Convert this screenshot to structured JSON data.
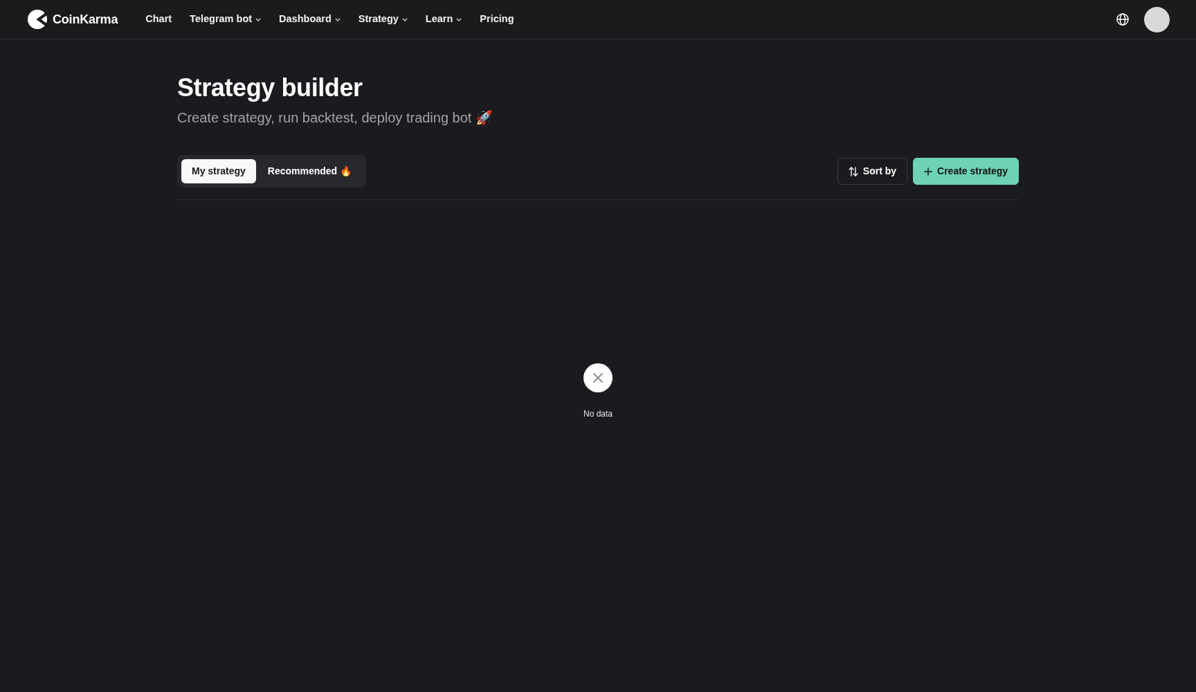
{
  "navbar": {
    "brand": "CoinKarma",
    "links": [
      {
        "label": "Chart",
        "has_menu": false
      },
      {
        "label": "Telegram bot",
        "has_menu": true
      },
      {
        "label": "Dashboard",
        "has_menu": true
      },
      {
        "label": "Strategy",
        "has_menu": true
      },
      {
        "label": "Learn",
        "has_menu": true
      },
      {
        "label": "Pricing",
        "has_menu": false
      }
    ]
  },
  "header": {
    "title": "Strategy builder",
    "subtitle": "Create strategy, run backtest, deploy trading bot 🚀"
  },
  "tabs": [
    {
      "label": "My strategy",
      "selected": true
    },
    {
      "label": "Recommended 🔥",
      "selected": false
    }
  ],
  "actions": [
    {
      "label": "Sort by",
      "kind": "sort"
    },
    {
      "label": "Create strategy",
      "kind": "create"
    }
  ],
  "empty_state": {
    "message": "No data"
  }
}
